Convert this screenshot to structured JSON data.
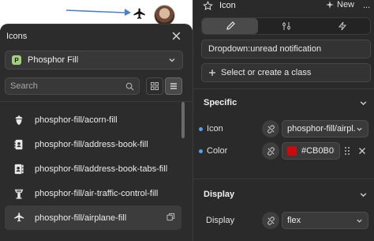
{
  "canvas": {},
  "icons_panel": {
    "title": "Icons",
    "library": {
      "badge": "P",
      "name": "Phosphor Fill"
    },
    "search": {
      "value": "",
      "placeholder": "Search"
    },
    "items": [
      {
        "label": "phosphor-fill/acorn-fill",
        "icon": "acorn-icon"
      },
      {
        "label": "phosphor-fill/address-book-fill",
        "icon": "address-book-icon"
      },
      {
        "label": "phosphor-fill/address-book-tabs-fill",
        "icon": "address-book-tabs-icon"
      },
      {
        "label": "phosphor-fill/air-traffic-control-fill",
        "icon": "air-traffic-control-icon"
      },
      {
        "label": "phosphor-fill/airplane-fill",
        "icon": "airplane-icon",
        "active": true
      }
    ]
  },
  "right_panel": {
    "title": "Icon",
    "new_label": "New",
    "more_label": "...",
    "dropdown_label": "Dropdown:unread notification",
    "class_label": "Select or create a class",
    "specific": {
      "title": "Specific",
      "icon_label": "Icon",
      "icon_value": "phosphor-fill/airpl...",
      "color_label": "Color",
      "color_value": "#CB0B0B"
    },
    "display": {
      "title": "Display",
      "label": "Display",
      "value": "flex"
    }
  },
  "colors": {
    "accent_dot": "#5aa0e6",
    "swatch": "#CB0B0B",
    "arrow": "#4a7fd4"
  }
}
